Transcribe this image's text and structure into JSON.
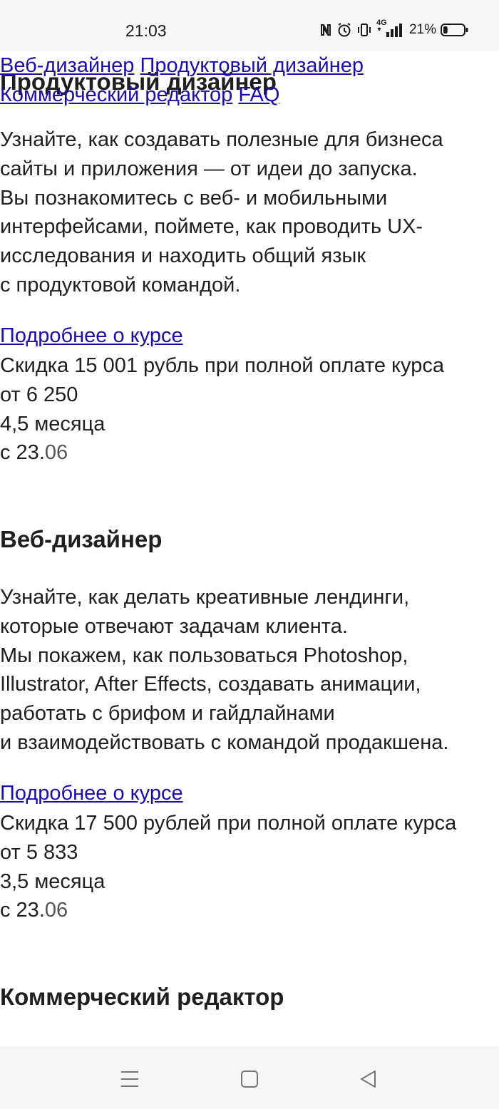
{
  "status_bar": {
    "time": "21:03",
    "icons": [
      "nfc-icon",
      "alarm-icon",
      "vibrate-icon",
      "signal-4g-icon"
    ],
    "network": "4G",
    "battery_percent": "21%",
    "battery_level": 0.21
  },
  "nav": {
    "links": [
      "Веб-дизайнер",
      "Продуктовый дизайнер",
      "Коммерческий редактор",
      "FAQ"
    ]
  },
  "courses": [
    {
      "title": "Продуктовый дизайнер",
      "description": "Узнайте, как создавать полезные для бизнеса\nсайты и приложения — от идеи до запуска.\nВы познакомитесь с веб- и мобильными\nинтерфейсами, поймете, как проводить UX-\nисследования и находить общий язык\nс продуктовой командой.",
      "more_link": "Подробнее о курсе",
      "discount": "Скидка 15 001 рубль при полной оплате курса",
      "price": "от 6 250",
      "duration": "4,5 месяца",
      "start_prefix": "с 23.",
      "start_month": "06"
    },
    {
      "title": "Веб-дизайнер",
      "description": "Узнайте, как делать креативные лендинги,\nкоторые отвечают задачам клиента.\nМы покажем, как пользоваться Photoshop,\nIllustrator, After Effects, создавать анимации,\nработать с брифом и гайдлайнами\nи взаимодействовать с командой продакшена.",
      "more_link": "Подробнее о курсе",
      "discount": "Скидка 17 500 рублей при полной оплате курса",
      "price": "от 5 833",
      "duration": "3,5 месяца",
      "start_prefix": "с 23.",
      "start_month": "06"
    },
    {
      "title": "Коммерческий редактор"
    }
  ],
  "system_nav": {
    "buttons": [
      "menu-icon",
      "home-icon",
      "back-icon"
    ]
  }
}
